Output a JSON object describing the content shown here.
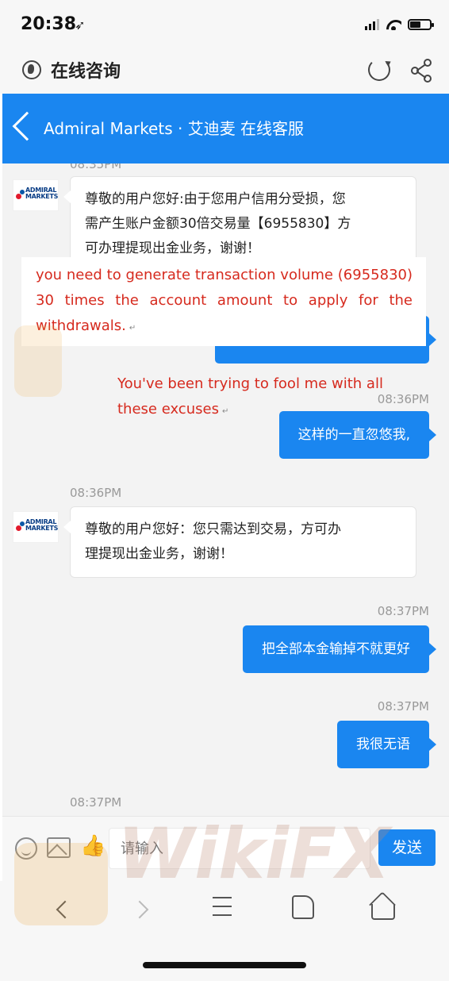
{
  "status_bar": {
    "time": "20:38",
    "battery_level": 0.55
  },
  "browser": {
    "title": "在线咨询"
  },
  "header": {
    "title": "Admiral Markets · 艾迪麦 在线客服"
  },
  "avatar": {
    "brand_line1": "ADMIRAL",
    "brand_line2": "MARKETS"
  },
  "messages": [
    {
      "side": "in",
      "text_lines": [
        "尊敬的用户您好:由于您用户信用分受损，您",
        "需产生账户金额30倍交易量【6955830】方",
        "可办理提现出金业务，谢谢！"
      ]
    },
    {
      "side": "out",
      "text": "这样的一直忽悠我,",
      "time": "08:36PM"
    },
    {
      "side": "in",
      "text_lines": [
        "尊敬的用户您好：您只需达到交易，方可办",
        "理提现出金业务，谢谢！"
      ],
      "time": "08:36PM"
    },
    {
      "side": "out",
      "text": "把全部本金输掉不就更好",
      "time": "08:37PM"
    },
    {
      "side": "out",
      "text": "我很无语",
      "time": "08:37PM"
    },
    {
      "side": "in",
      "time": "08:37PM"
    }
  ],
  "annotations": {
    "translation": "you need to generate transaction volume (6955830) 30 times the account amount to apply for the withdrawals.",
    "comment_line1": "You've been trying to fool me with all",
    "comment_line2": "these excuses"
  },
  "input_bar": {
    "placeholder": "请输入",
    "send_label": "发送"
  },
  "watermark": {
    "text": "WikiFX"
  },
  "colors": {
    "accent": "#1a86f0",
    "annotation": "#d62a1e"
  }
}
